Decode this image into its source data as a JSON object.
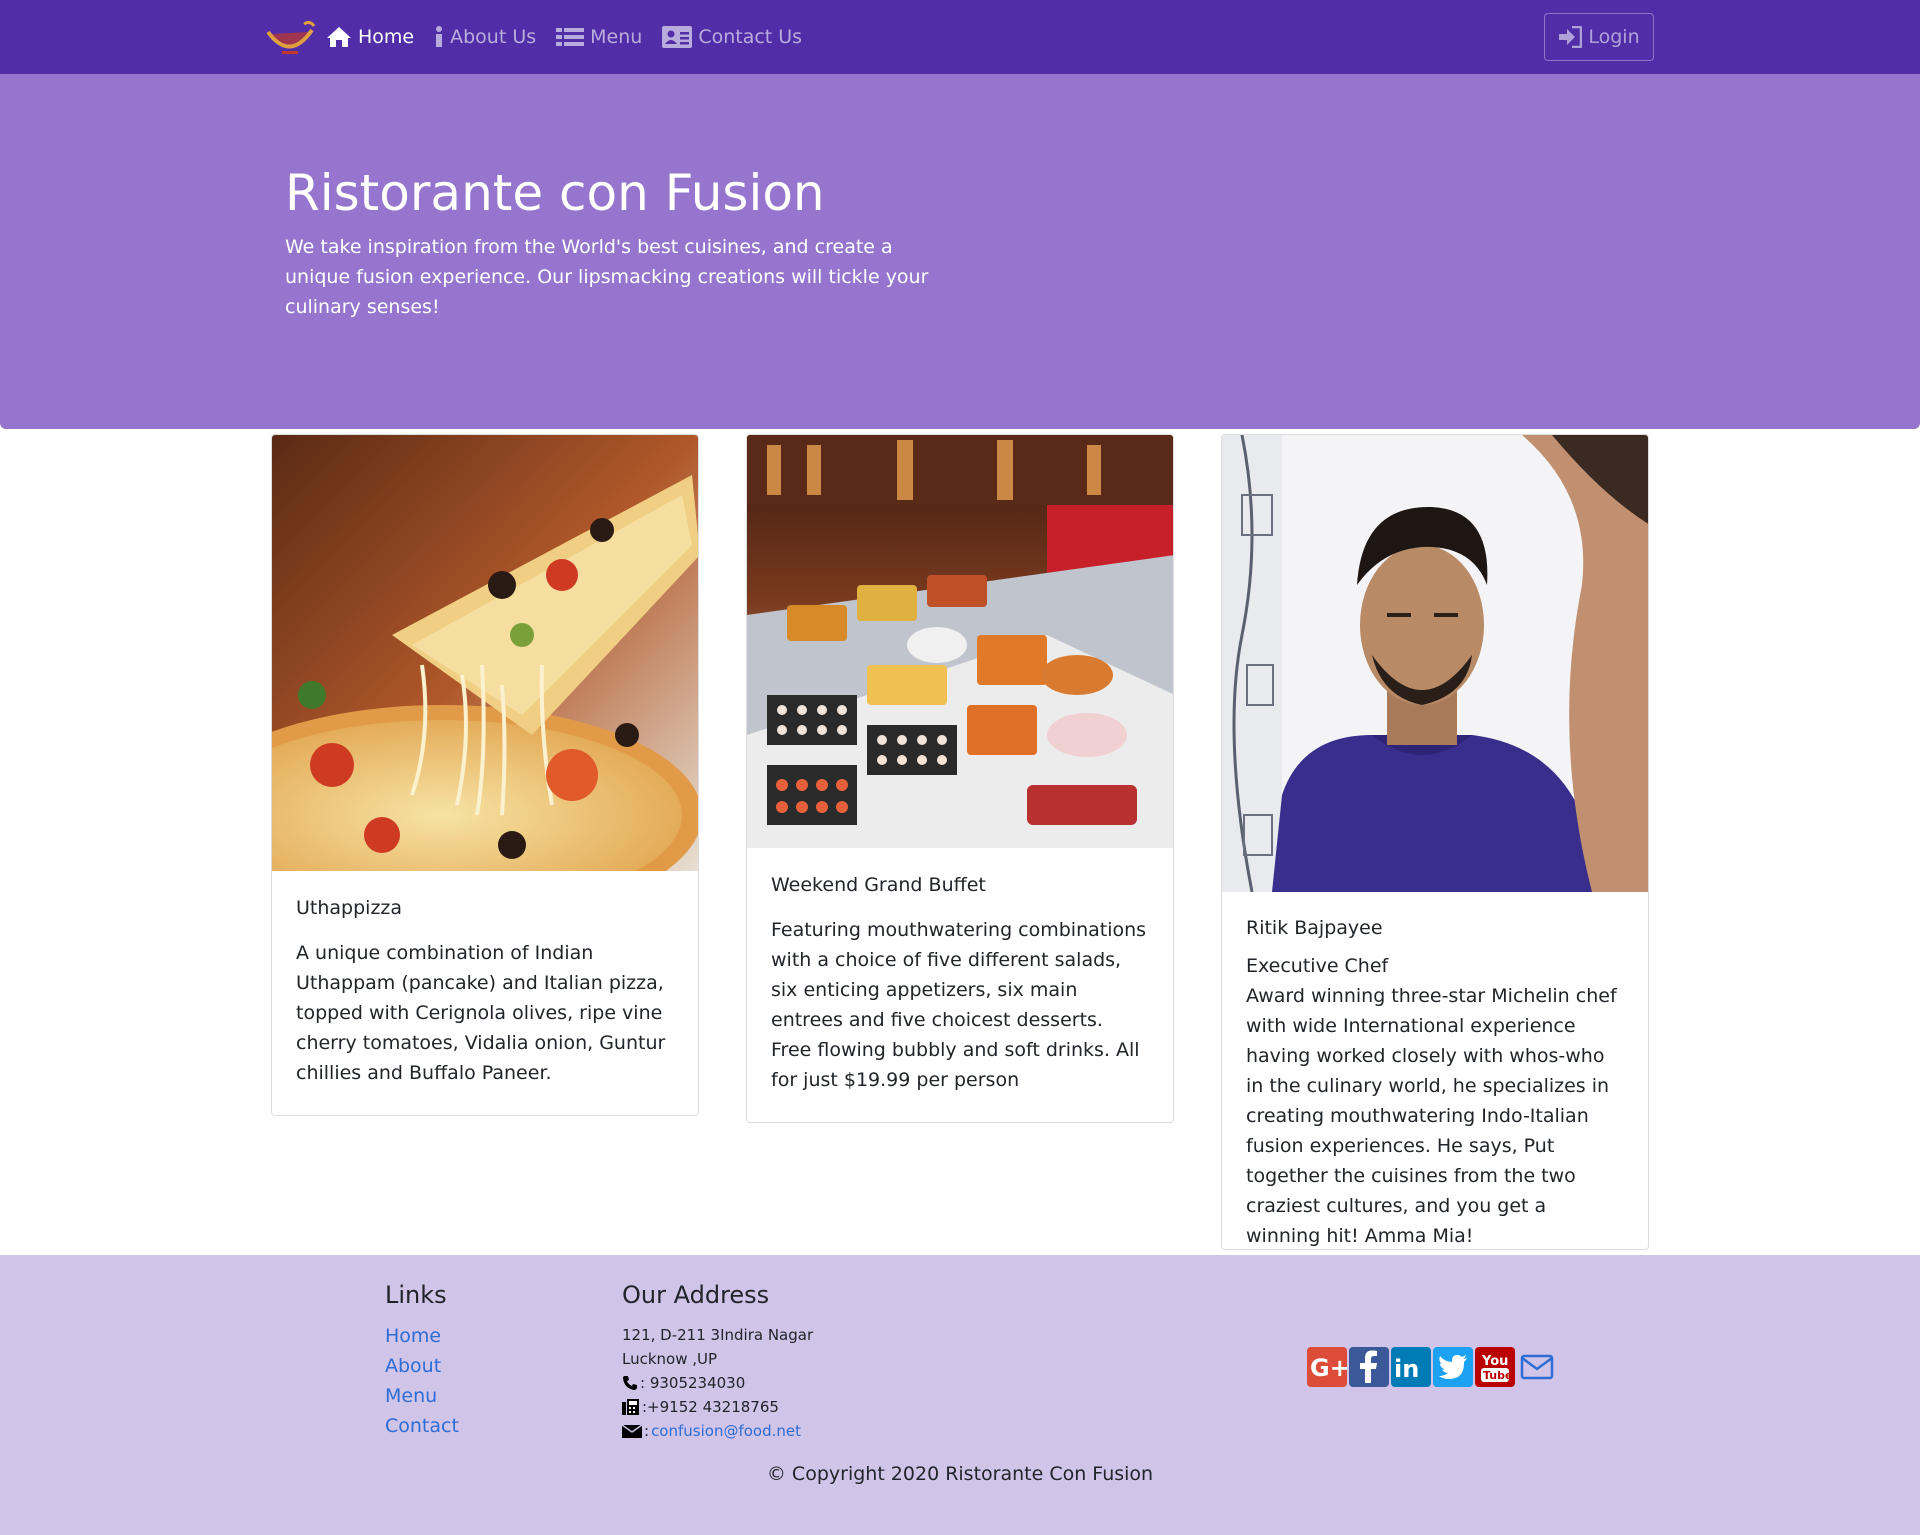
{
  "nav": {
    "items": [
      {
        "label": "Home",
        "icon": "home-icon",
        "active": true
      },
      {
        "label": "About Us",
        "icon": "info-icon",
        "active": false
      },
      {
        "label": "Menu",
        "icon": "list-icon",
        "active": false
      },
      {
        "label": "Contact Us",
        "icon": "address-card-icon",
        "active": false
      }
    ],
    "login_label": "Login"
  },
  "jumbotron": {
    "title": "Ristorante con Fusion",
    "text": "We take inspiration from the World's best cuisines, and create a unique fusion experience. Our lipsmacking creations will tickle your culinary senses!"
  },
  "cards": [
    {
      "title": "Uthappizza",
      "subtitle": "",
      "text": "A unique combination of Indian Uthappam (pancake) and Italian pizza, topped with Cerignola olives, ripe vine cherry tomatoes, Vidalia onion, Guntur chillies and Buffalo Paneer."
    },
    {
      "title": "Weekend Grand Buffet",
      "subtitle": "",
      "text": "Featuring mouthwatering combinations with a choice of five different salads, six enticing appetizers, six main entrees and five choicest desserts. Free flowing bubbly and soft drinks. All for just $19.99 per person"
    },
    {
      "title": "Ritik Bajpayee",
      "subtitle": "Executive Chef",
      "text": "Award winning three-star Michelin chef with wide International experience having worked closely with whos-who in the culinary world, he specializes in creating mouthwatering Indo-Italian fusion experiences. He says, Put together the cuisines from the two craziest cultures, and you get a winning hit! Amma Mia!"
    }
  ],
  "footer": {
    "links_heading": "Links",
    "links": [
      "Home",
      "About",
      "Menu",
      "Contact"
    ],
    "address_heading": "Our Address",
    "address_line1": "121, D-211 3Indira Nagar",
    "address_line2": "Lucknow ,UP",
    "phone": ": 9305234030",
    "fax": ":+9152 43218765",
    "email_prefix": ": ",
    "email": "confusion@food.net",
    "social": [
      "google-plus-icon",
      "facebook-icon",
      "linkedin-icon",
      "twitter-icon",
      "youtube-icon",
      "envelope-icon"
    ],
    "copyright": "© Copyright 2020 Ristorante Con Fusion"
  },
  "colors": {
    "navbar": "#512da8",
    "jumbotron": "#9575cd",
    "footer": "#d1c4e9",
    "link": "#2d6dd6"
  }
}
